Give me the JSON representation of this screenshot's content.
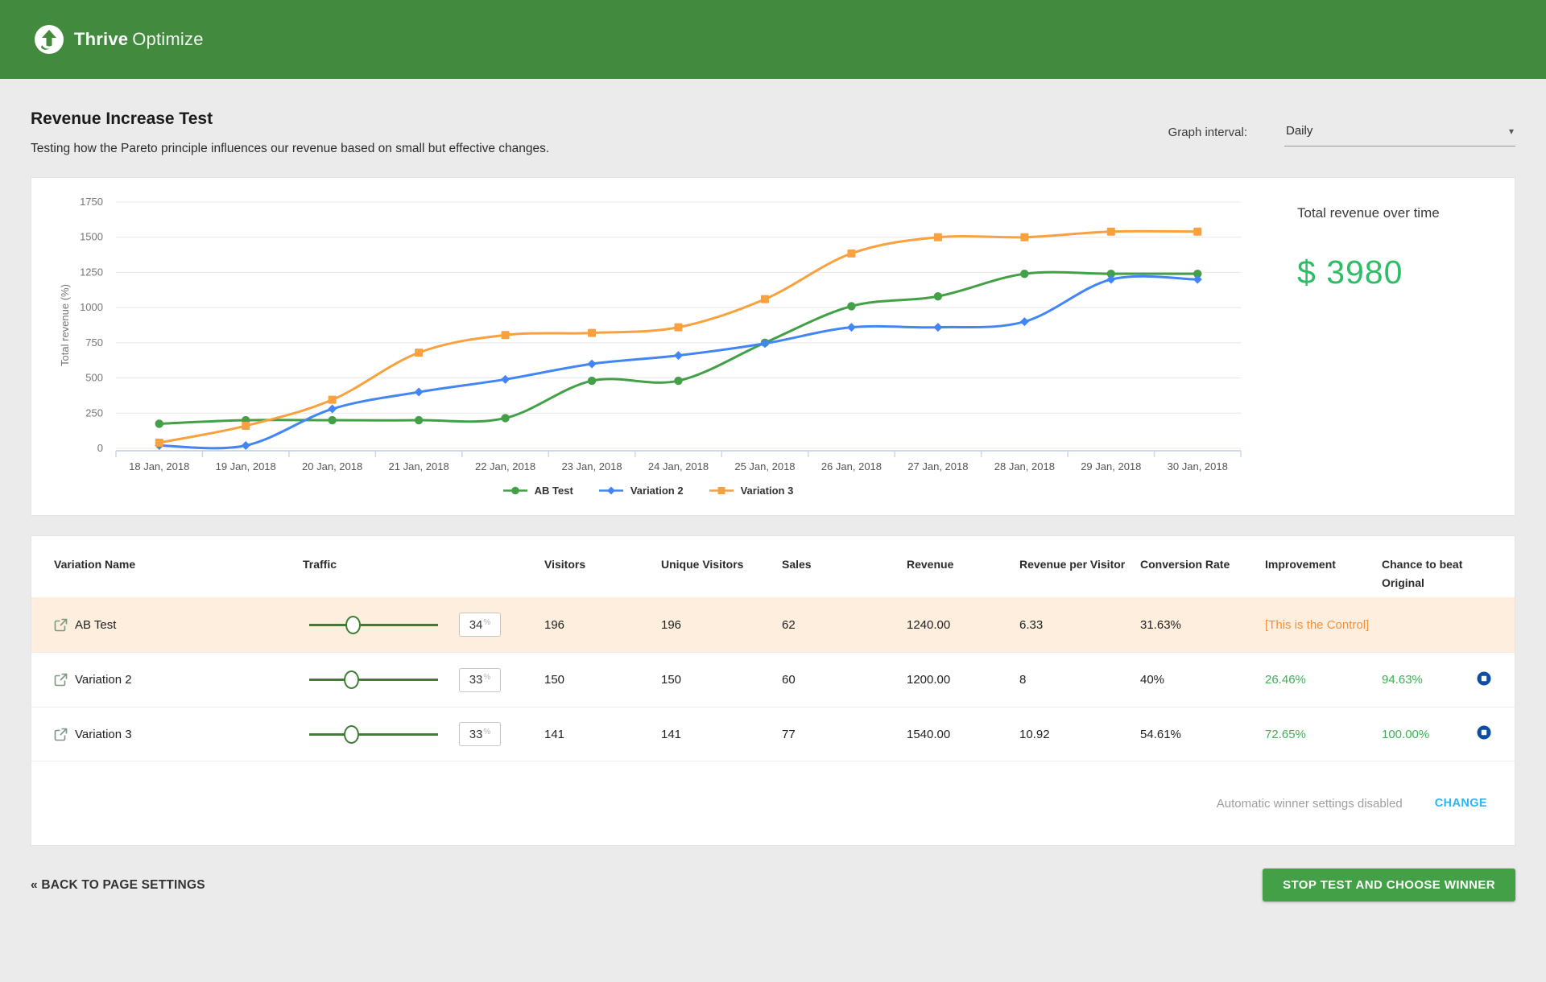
{
  "header": {
    "brand_bold": "Thrive",
    "brand_light": "Optimize"
  },
  "page": {
    "title": "Revenue Increase Test",
    "subtitle": "Testing how the Pareto principle influences our revenue based on small but effective changes.",
    "graph_interval_label": "Graph interval:",
    "graph_interval_value": "Daily"
  },
  "icons": {
    "caret": "▾"
  },
  "chart_data": {
    "type": "line",
    "ylabel": "Total revenue (%)",
    "ylim": [
      0,
      1750
    ],
    "ytick_step": 250,
    "grid": true,
    "legend_position": "bottom",
    "categories": [
      "18 Jan, 2018",
      "19 Jan, 2018",
      "20 Jan, 2018",
      "21 Jan, 2018",
      "22 Jan, 2018",
      "23 Jan, 2018",
      "24 Jan, 2018",
      "25 Jan, 2018",
      "26 Jan, 2018",
      "27 Jan, 2018",
      "28 Jan, 2018",
      "29 Jan, 2018",
      "30 Jan, 2018"
    ],
    "series": [
      {
        "name": "AB Test",
        "color": "#43a047",
        "marker": "circle",
        "values": [
          175,
          200,
          200,
          200,
          215,
          480,
          480,
          750,
          1010,
          1080,
          1240,
          1240,
          1240
        ]
      },
      {
        "name": "Variation 2",
        "color": "#4285f4",
        "marker": "diamond",
        "values": [
          20,
          20,
          280,
          400,
          490,
          600,
          660,
          745,
          860,
          860,
          900,
          1200,
          1200
        ]
      },
      {
        "name": "Variation 3",
        "color": "#f9a13e",
        "marker": "square",
        "values": [
          40,
          160,
          345,
          680,
          805,
          820,
          860,
          1060,
          1385,
          1500,
          1500,
          1540,
          1540
        ]
      }
    ]
  },
  "summary": {
    "label": "Total revenue over time",
    "value": "$ 3980",
    "value_color": "#2ebd66"
  },
  "table": {
    "columns": [
      "Variation Name",
      "Traffic",
      "Visitors",
      "Unique Visitors",
      "Sales",
      "Revenue",
      "Revenue per Visitor",
      "Conversion Rate",
      "Improvement",
      "Chance to beat Original"
    ],
    "traffic_unit": "%",
    "rows": [
      {
        "name": "AB Test",
        "traffic": "34",
        "traffic_pct": 34,
        "visitors": "196",
        "unique_visitors": "196",
        "sales": "62",
        "revenue": "1240.00",
        "revenue_per_visitor": "6.33",
        "conversion_rate": "31.63%",
        "improvement": "[This is the Control]",
        "improvement_type": "control",
        "chance": "",
        "has_stop": false,
        "highlight": true
      },
      {
        "name": "Variation 2",
        "traffic": "33",
        "traffic_pct": 33,
        "visitors": "150",
        "unique_visitors": "150",
        "sales": "60",
        "revenue": "1200.00",
        "revenue_per_visitor": "8",
        "conversion_rate": "40%",
        "improvement": "26.46%",
        "improvement_type": "positive",
        "chance": "94.63%",
        "has_stop": true,
        "highlight": false
      },
      {
        "name": "Variation 3",
        "traffic": "33",
        "traffic_pct": 33,
        "visitors": "141",
        "unique_visitors": "141",
        "sales": "77",
        "revenue": "1540.00",
        "revenue_per_visitor": "10.92",
        "conversion_rate": "54.61%",
        "improvement": "72.65%",
        "improvement_type": "positive",
        "chance": "100.00%",
        "has_stop": true,
        "highlight": false
      }
    ],
    "footer": {
      "auto_winner_text": "Automatic winner settings disabled",
      "change_label": "CHANGE"
    }
  },
  "actions": {
    "back_label": "« BACK TO PAGE SETTINGS",
    "stop_label": "STOP TEST AND CHOOSE WINNER"
  }
}
